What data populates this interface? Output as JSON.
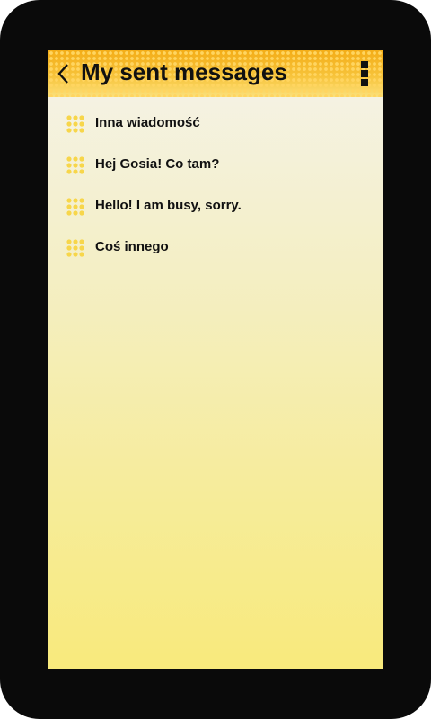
{
  "header": {
    "title": "My sent messages",
    "back_icon": "chevron-left-icon",
    "menu_icon": "overflow-menu-icon",
    "accent_color": "#f5b21c"
  },
  "messages": [
    {
      "label": "Inna wiadomość",
      "icon": "dot-grid-icon"
    },
    {
      "label": "Hej Gosia! Co tam?",
      "icon": "dot-grid-icon"
    },
    {
      "label": "Hello! I am busy, sorry.",
      "icon": "dot-grid-icon"
    },
    {
      "label": "Coś innego",
      "icon": "dot-grid-icon"
    }
  ],
  "colors": {
    "frame": "#0a0a0a",
    "screen_top": "#f5f3ea",
    "screen_bottom": "#f8ea7c",
    "dot_icon": "#f7d64a"
  }
}
